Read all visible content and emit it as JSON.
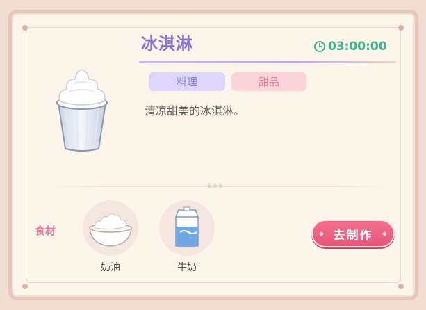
{
  "recipe": {
    "title": "冰淇淋",
    "timer": "03:00:00",
    "tags": [
      "料理",
      "甜品"
    ],
    "description": "清凉甜美的冰淇淋。"
  },
  "ingredients": {
    "label": "食材",
    "items": [
      {
        "name": "奶油",
        "icon": "cream-bowl-icon"
      },
      {
        "name": "牛奶",
        "icon": "milk-carton-icon"
      }
    ]
  },
  "actions": {
    "make_label": "去制作"
  },
  "colors": {
    "title": "#8b72d6",
    "timer": "#38b78a",
    "tag_cuisine_bg": "#ddd6fa",
    "tag_dessert_bg": "#fad4d9",
    "button": "#e75679",
    "ingredients_label": "#ea7da0"
  }
}
